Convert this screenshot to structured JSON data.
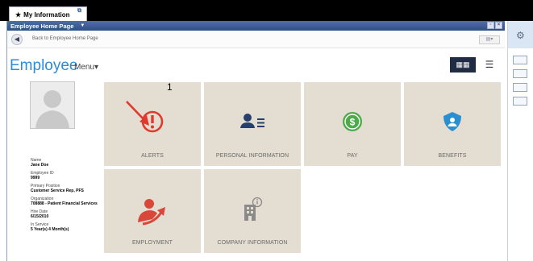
{
  "window": {
    "tab_label": "My Information",
    "title": "Employee Home Page"
  },
  "nav": {
    "back_label": "Back to Employee Home Page"
  },
  "header": {
    "title": "Employee",
    "menu_label": "Menu"
  },
  "profile": {
    "fields": [
      {
        "label": "Name",
        "value": "Jane Doe"
      },
      {
        "label": "Employee ID",
        "value": "9999"
      },
      {
        "label": "Primary Position",
        "value": "Customer Service Rep, PFS"
      },
      {
        "label": "Organization",
        "value": "708888 - Patient Financial Services"
      },
      {
        "label": "Hire Date",
        "value": "6/15/2010"
      },
      {
        "label": "In Service",
        "value": "5 Year(s) 4 Month(s)"
      }
    ]
  },
  "tiles": [
    {
      "label": "ALERTS",
      "icon": "alert-icon"
    },
    {
      "label": "PERSONAL INFORMATION",
      "icon": "person-list-icon"
    },
    {
      "label": "PAY",
      "icon": "dollar-icon"
    },
    {
      "label": "BENEFITS",
      "icon": "shield-person-icon"
    },
    {
      "label": "EMPLOYMENT",
      "icon": "employment-arrow-icon"
    },
    {
      "label": "COMPANY INFORMATION",
      "icon": "building-info-icon"
    }
  ],
  "alerts": {
    "count": "1"
  },
  "colors": {
    "accent_blue": "#2e8bd6",
    "tile_bg": "#e4ddd1",
    "alert_red": "#e03a2e",
    "icon_navy": "#26406b",
    "pay_green": "#4caa48",
    "benefits_blue": "#2a8fd0",
    "employment_red": "#d9463a"
  }
}
